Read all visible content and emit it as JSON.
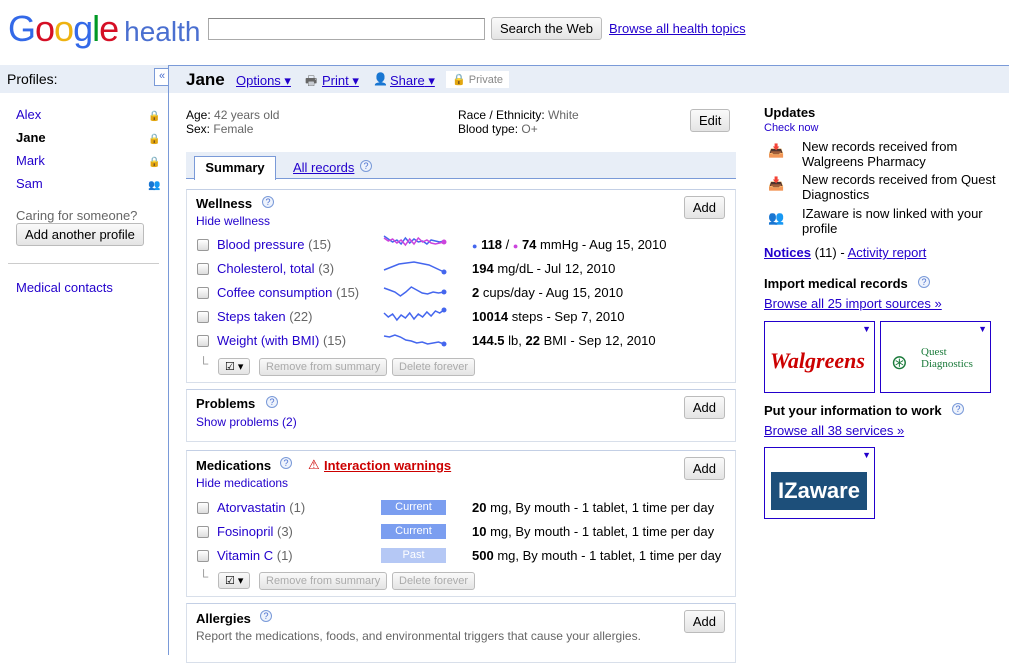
{
  "header": {
    "logo_google": "Google",
    "logo_health": "health",
    "search_button": "Search the Web",
    "browse_link": "Browse all health topics",
    "search_value": ""
  },
  "sidebar": {
    "title": "Profiles:",
    "collapse": "«",
    "profiles": [
      {
        "name": "Alex"
      },
      {
        "name": "Jane"
      },
      {
        "name": "Mark"
      },
      {
        "name": "Sam"
      }
    ],
    "caring": "Caring for someone?",
    "add_profile": "Add another profile",
    "medical_contacts": "Medical contacts"
  },
  "profile": {
    "name": "Jane",
    "options": "Options",
    "print": "Print",
    "share": "Share",
    "private": "Private",
    "age_label": "Age:",
    "age": "42 years old",
    "sex_label": "Sex:",
    "sex": "Female",
    "race_label": "Race / Ethnicity:",
    "race": "White",
    "blood_label": "Blood type:",
    "blood": "O+",
    "edit": "Edit"
  },
  "tabs": {
    "summary": "Summary",
    "all_records": "All records"
  },
  "wellness": {
    "title": "Wellness",
    "toggle": "Hide wellness",
    "add": "Add",
    "items": [
      {
        "name": "Blood pressure",
        "count": "(15)",
        "v1": "118",
        "sep": " / ",
        "v2": "74",
        "rest": " mmHg - Aug 15, 2010"
      },
      {
        "name": "Cholesterol, total",
        "count": "(3)",
        "v1": "194",
        "rest": " mg/dL - Jul 12, 2010"
      },
      {
        "name": "Coffee consumption",
        "count": "(15)",
        "v1": "2",
        "rest": " cups/day - Aug 15, 2010"
      },
      {
        "name": "Steps taken",
        "count": "(22)",
        "v1": "10014",
        "rest": " steps - Sep 7, 2010"
      },
      {
        "name": "Weight (with BMI)",
        "count": "(15)",
        "v1": "144.5",
        "sep": " lb, ",
        "v2": "22",
        "rest": " BMI - Sep 12, 2010"
      }
    ]
  },
  "actions": {
    "remove": "Remove from summary",
    "delete": "Delete forever"
  },
  "problems": {
    "title": "Problems",
    "toggle": "Show problems (2)",
    "add": "Add"
  },
  "medications": {
    "title": "Medications",
    "warning": "Interaction warnings",
    "toggle": "Hide medications",
    "add": "Add",
    "items": [
      {
        "name": "Atorvastatin",
        "count": "(1)",
        "status": "Current",
        "dose": "20",
        "rest": " mg, By mouth - 1 tablet, 1 time per day"
      },
      {
        "name": "Fosinopril",
        "count": "(3)",
        "status": "Current",
        "dose": "10",
        "rest": " mg, By mouth - 1 tablet, 1 time per day"
      },
      {
        "name": "Vitamin C",
        "count": "(1)",
        "status": "Past",
        "dose": "500",
        "rest": " mg, By mouth - 1 tablet, 1 time per day"
      }
    ]
  },
  "allergies": {
    "title": "Allergies",
    "desc": "Report the medications, foods, and environmental triggers that cause your allergies.",
    "add": "Add"
  },
  "updates": {
    "title": "Updates",
    "check": "Check now",
    "items": [
      "New records received from Walgreens Pharmacy",
      "New records received from Quest Diagnostics",
      "IZaware is now linked with your profile"
    ],
    "notices": "Notices",
    "notices_count": " (11) - ",
    "activity": "Activity report"
  },
  "import": {
    "title": "Import medical records",
    "browse": "Browse all 25 import sources »",
    "walgreens": "Walgreens",
    "quest": "Quest Diagnostics"
  },
  "services": {
    "title": "Put your information to work",
    "browse": "Browse all 38 services »",
    "izaware": "IZaware"
  },
  "colors": {
    "link": "#2200cc",
    "band": "#e8eef7",
    "systolic": "#4466ee",
    "diastolic": "#cc44dd",
    "warning": "#cc0000"
  }
}
